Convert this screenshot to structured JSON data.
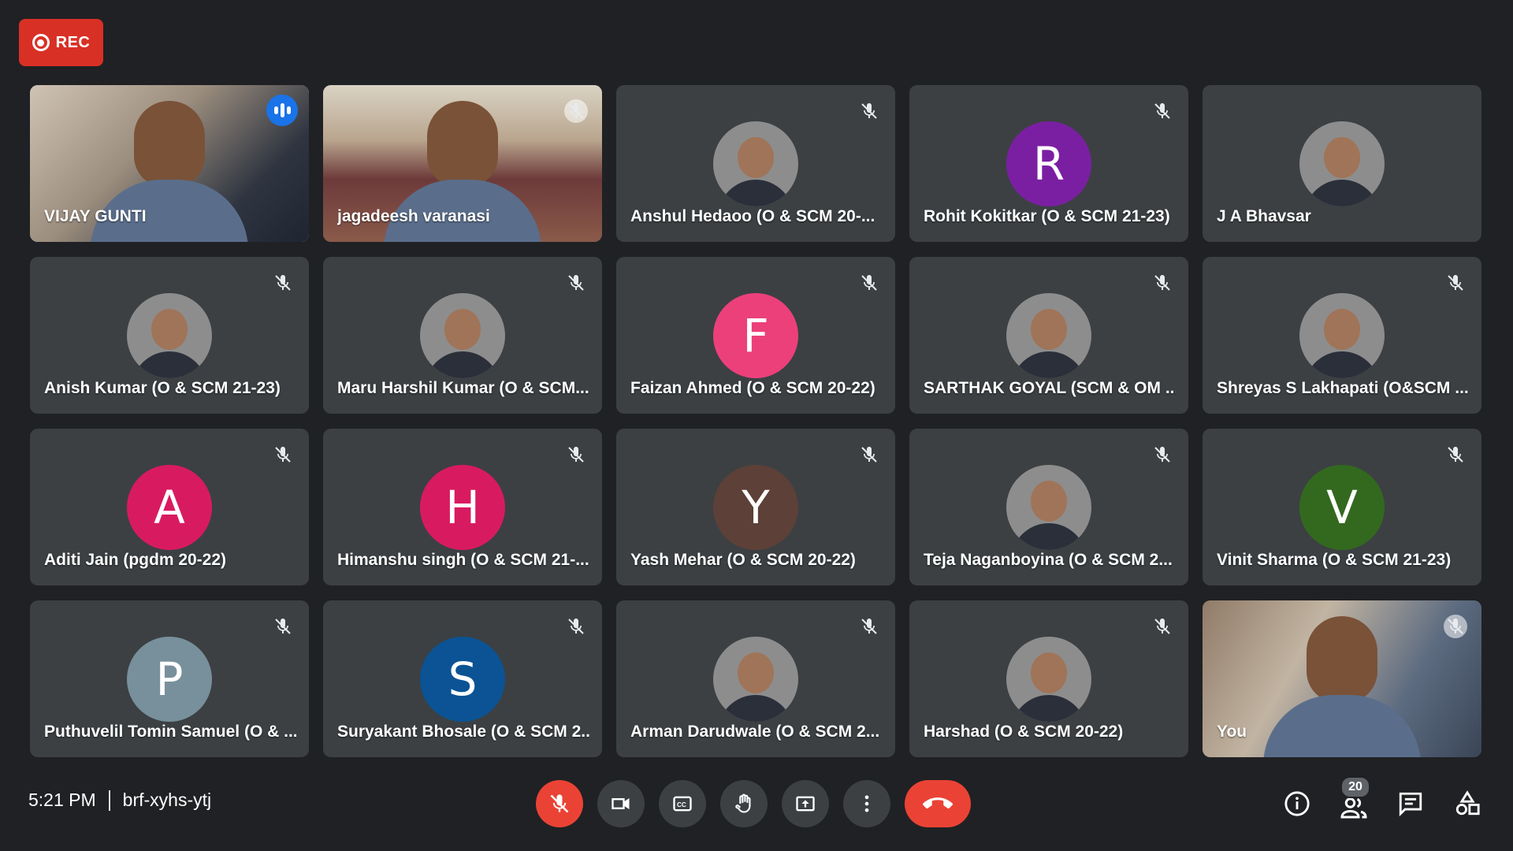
{
  "recording": {
    "label": "REC"
  },
  "participants": [
    {
      "name": "VIJAY GUNTI",
      "kind": "video",
      "speaking": true,
      "muted": false
    },
    {
      "name": "jagadeesh varanasi",
      "kind": "video",
      "speaking": false,
      "muted": true
    },
    {
      "name": "Anshul Hedaoo (O & SCM 20-...",
      "kind": "photo",
      "muted": true
    },
    {
      "name": "Rohit Kokitkar (O & SCM 21-23)",
      "kind": "initial",
      "initial": "R",
      "color": "#7b1fa2",
      "muted": true
    },
    {
      "name": "J A Bhavsar",
      "kind": "photo",
      "muted": false
    },
    {
      "name": "Anish Kumar (O & SCM 21-23)",
      "kind": "photo",
      "muted": true
    },
    {
      "name": "Maru Harshil Kumar (O & SCM...",
      "kind": "photo",
      "muted": true
    },
    {
      "name": "Faizan Ahmed (O & SCM 20-22)",
      "kind": "initial",
      "initial": "F",
      "color": "#ec407a",
      "muted": true
    },
    {
      "name": "SARTHAK GOYAL (SCM & OM ...",
      "kind": "photo",
      "muted": true
    },
    {
      "name": "Shreyas S Lakhapati (O&SCM ...",
      "kind": "photo",
      "muted": true
    },
    {
      "name": "Aditi Jain (pgdm 20-22)",
      "kind": "initial",
      "initial": "A",
      "color": "#d81b60",
      "muted": true
    },
    {
      "name": "Himanshu singh (O & SCM 21-...",
      "kind": "initial",
      "initial": "H",
      "color": "#d81b60",
      "muted": true
    },
    {
      "name": "Yash Mehar (O & SCM 20-22)",
      "kind": "initial",
      "initial": "Y",
      "color": "#5d4037",
      "muted": true
    },
    {
      "name": "Teja Naganboyina (O & SCM 2...",
      "kind": "photo",
      "muted": true
    },
    {
      "name": "Vinit Sharma (O & SCM 21-23)",
      "kind": "initial",
      "initial": "V",
      "color": "#33691e",
      "muted": true
    },
    {
      "name": "Puthuvelil Tomin Samuel (O & ...",
      "kind": "initial",
      "initial": "P",
      "color": "#78909c",
      "muted": true
    },
    {
      "name": "Suryakant Bhosale (O & SCM 2...",
      "kind": "initial",
      "initial": "S",
      "color": "#0b5394",
      "muted": true
    },
    {
      "name": "Arman Darudwale (O & SCM 2...",
      "kind": "photo",
      "muted": true
    },
    {
      "name": "Harshad (O & SCM 20-22)",
      "kind": "photo",
      "muted": true
    },
    {
      "name": "You",
      "kind": "video",
      "speaking": false,
      "muted": true
    }
  ],
  "meeting": {
    "time": "5:21 PM",
    "code": "brf-xyhs-ytj"
  },
  "controls": [
    "microphone-off",
    "camera",
    "captions",
    "raise-hand",
    "present-screen",
    "more-options",
    "leave-call"
  ],
  "right_controls": {
    "people_count": "20"
  },
  "colors": {
    "background": "#202124",
    "tile": "#3c4043",
    "accent": "#8ab4f8",
    "danger": "#ea4335"
  }
}
